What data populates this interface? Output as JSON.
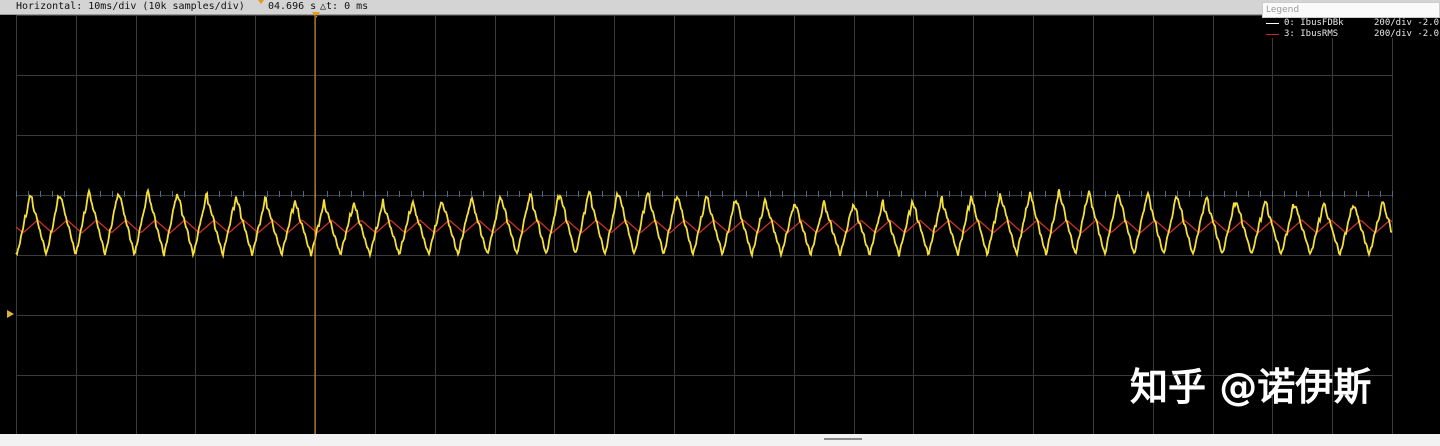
{
  "status_bar": {
    "horizontal": "Horizontal: 10ms/div (10k samples/div)",
    "trigger_time": "04.696 s",
    "delta_t": "△t: 0 ms"
  },
  "legend": {
    "title": "Legend",
    "channels": [
      {
        "label": "0: IbusFDBk",
        "scale": "200/div -2.0",
        "color": "#ffffff"
      },
      {
        "label": "3: IbusRMS",
        "scale": "200/div -2.0",
        "color": "#c0282a"
      }
    ]
  },
  "traces": {
    "ch0_color": "#f5df3a",
    "ch3_color": "#c8322a"
  },
  "watermark": "知乎 @诺伊斯",
  "icons": {
    "trigger_marker": "trigger-marker-icon",
    "ground_marker": "ground-level-marker-icon"
  }
}
